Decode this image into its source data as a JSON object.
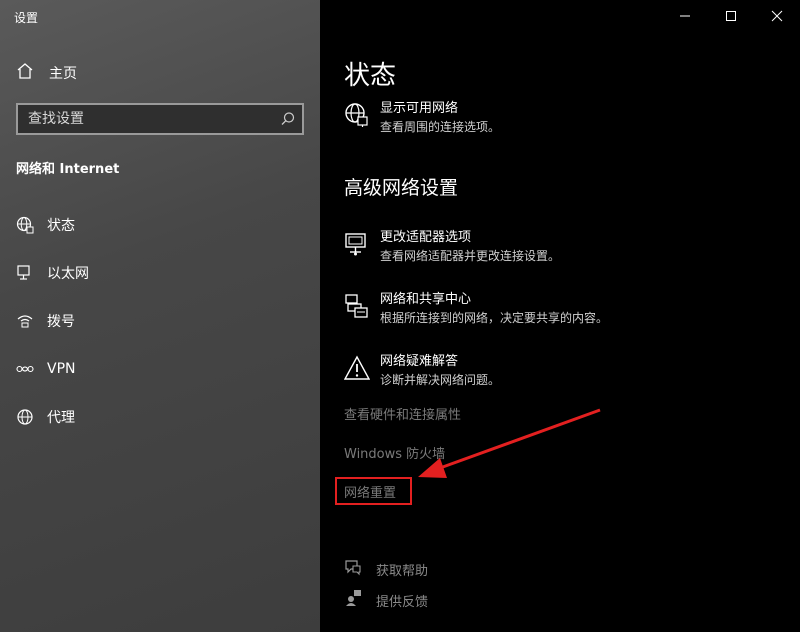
{
  "window": {
    "title": "设置",
    "minimize_icon": "minimize-icon",
    "maximize_icon": "maximize-icon",
    "close_icon": "close-icon"
  },
  "sidebar": {
    "home": {
      "label": "主页",
      "icon": "home-icon"
    },
    "search": {
      "placeholder": "查找设置",
      "icon": "search-icon"
    },
    "section_title": "网络和 Internet",
    "items": [
      {
        "label": "状态",
        "icon": "globe-status-icon"
      },
      {
        "label": "以太网",
        "icon": "ethernet-icon"
      },
      {
        "label": "拨号",
        "icon": "dialup-icon"
      },
      {
        "label": "VPN",
        "icon": "vpn-icon"
      },
      {
        "label": "代理",
        "icon": "globe-icon"
      }
    ]
  },
  "main": {
    "title": "状态",
    "show_networks": {
      "title": "显示可用网络",
      "desc": "查看周围的连接选项。",
      "icon": "network-globe-icon"
    },
    "advanced_title": "高级网络设置",
    "entries": [
      {
        "title": "更改适配器选项",
        "desc": "查看网络适配器并更改连接设置。",
        "icon": "adapter-icon"
      },
      {
        "title": "网络和共享中心",
        "desc": "根据所连接到的网络，决定要共享的内容。",
        "icon": "sharing-center-icon"
      },
      {
        "title": "网络疑难解答",
        "desc": "诊断并解决网络问题。",
        "icon": "warning-icon"
      }
    ],
    "links": [
      {
        "label": "查看硬件和连接属性"
      },
      {
        "label": "Windows 防火墙"
      },
      {
        "label": "网络重置"
      }
    ],
    "help": [
      {
        "label": "获取帮助",
        "icon": "help-chat-icon"
      },
      {
        "label": "提供反馈",
        "icon": "feedback-icon"
      }
    ]
  },
  "colors": {
    "highlight": "#e32020",
    "arrow": "#e32020"
  }
}
